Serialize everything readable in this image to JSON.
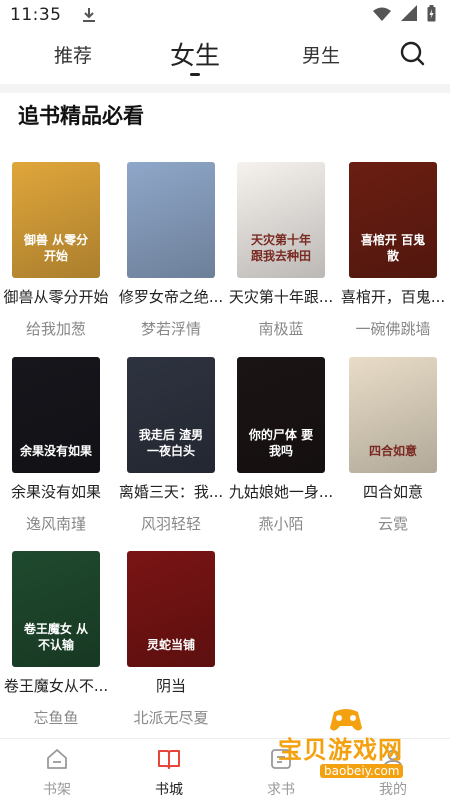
{
  "status_bar": {
    "time": "11:35",
    "icons": [
      "download-icon",
      "wifi-icon",
      "signal-icon",
      "battery-icon"
    ]
  },
  "top_tabs": {
    "items": [
      {
        "label": "推荐"
      },
      {
        "label": "女生",
        "active": true
      },
      {
        "label": "男生"
      }
    ],
    "search_icon": "search-icon"
  },
  "section": {
    "title": "追书精品必看"
  },
  "books": [
    {
      "title": "御兽从零分开始",
      "author": "给我加葱",
      "cover_text": "御兽 从零分开始",
      "cover_color": "#e0a63b"
    },
    {
      "title": "修罗女帝之绝...",
      "author": "梦若浮情",
      "cover_text": "",
      "cover_color": "#8fa7c9"
    },
    {
      "title": "天灾第十年跟...",
      "author": "南极蓝",
      "cover_text": "天灾第十年 跟我去种田",
      "cover_color": "#f6f2ee"
    },
    {
      "title": "喜棺开，百鬼...",
      "author": "一碗佛跳墙",
      "cover_text": "喜棺开 百鬼散",
      "cover_color": "#6b1e12"
    },
    {
      "title": "余果没有如果",
      "author": "逸风南瑾",
      "cover_text": "余果没有如果",
      "cover_color": "#16161c"
    },
    {
      "title": "离婚三天：我...",
      "author": "风羽轻轻",
      "cover_text": "我走后 渣男一夜白头",
      "cover_color": "#2e3340"
    },
    {
      "title": "九姑娘她一身...",
      "author": "燕小陌",
      "cover_text": "你的尸体 要我吗",
      "cover_color": "#1b1414"
    },
    {
      "title": "四合如意",
      "author": "云霓",
      "cover_text": "四合如意",
      "cover_color": "#e9ddc8"
    },
    {
      "title": "卷王魔女从不...",
      "author": "忘鱼鱼",
      "cover_text": "卷王魔女 从不认输",
      "cover_color": "#1f4a2e"
    },
    {
      "title": "阴当",
      "author": "北派无尽夏",
      "cover_text": "灵蛇当铺",
      "cover_color": "#7a1414"
    }
  ],
  "bottom_nav": {
    "items": [
      {
        "label": "书架",
        "icon": "bookshelf-icon"
      },
      {
        "label": "书城",
        "icon": "book-city-icon",
        "active": true
      },
      {
        "label": "求书",
        "icon": "request-book-icon"
      },
      {
        "label": "我的",
        "icon": "profile-icon"
      }
    ]
  },
  "watermark": {
    "title": "宝贝游戏网",
    "url": "baobeiy.com"
  }
}
